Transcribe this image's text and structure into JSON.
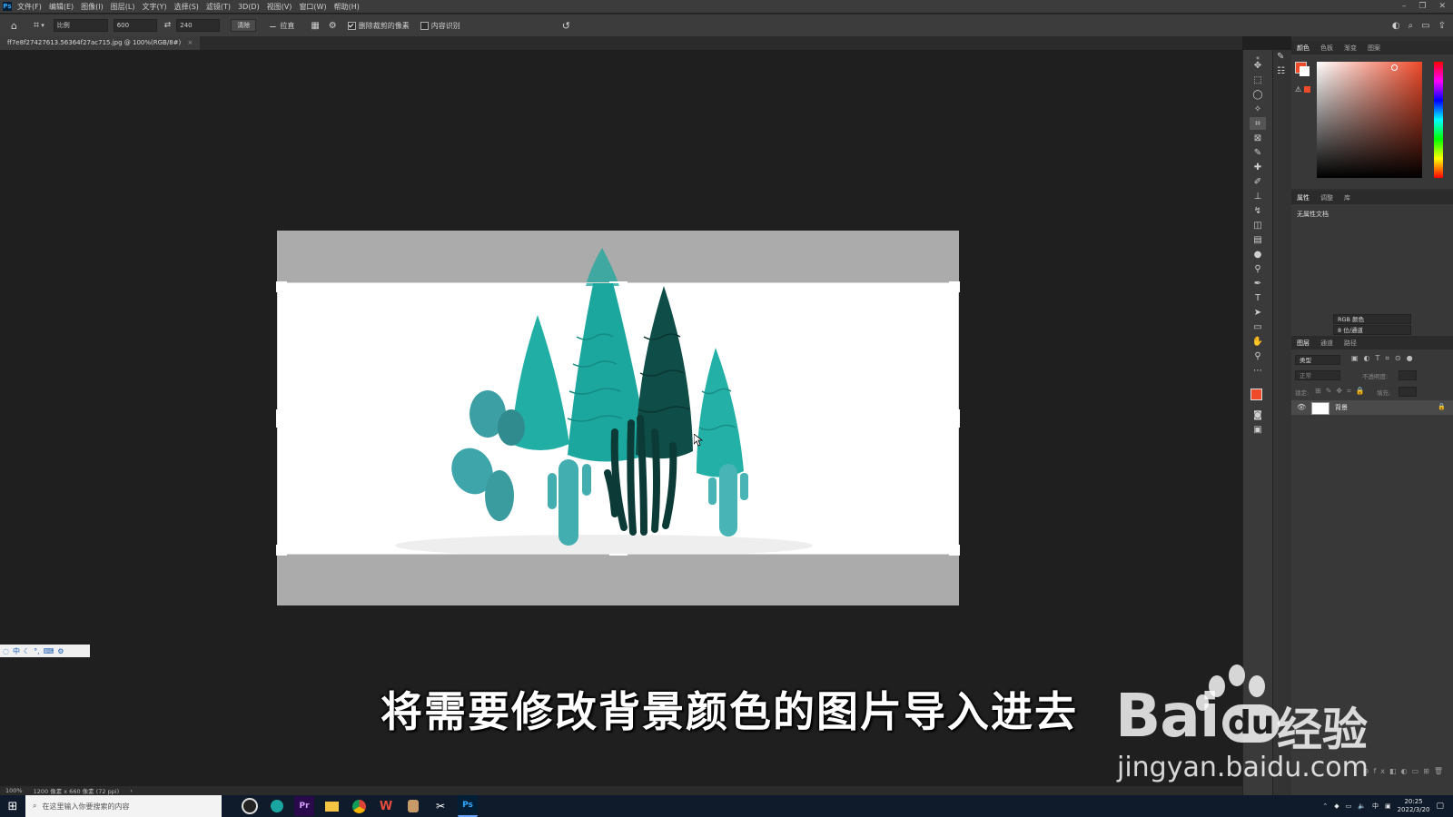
{
  "app": {
    "logo": "Ps",
    "menus": [
      "文件(F)",
      "编辑(E)",
      "图像(I)",
      "图层(L)",
      "文字(Y)",
      "选择(S)",
      "滤镜(T)",
      "3D(D)",
      "视图(V)",
      "窗口(W)",
      "帮助(H)"
    ]
  },
  "options": {
    "ratio_label": "比例",
    "width_value": "600",
    "height_value": "240",
    "clear_label": "清除",
    "straighten_label": "拉直",
    "delete_cropped_label": "删除裁剪的像素",
    "delete_cropped_checked": true,
    "content_aware_label": "内容识别",
    "content_aware_checked": false
  },
  "document": {
    "tab_title": "ff7e8f27427613.56364f27ac715.jpg @ 100%(RGB/8#)",
    "status_zoom": "100%",
    "status_info": "1200 像素 x 660 像素 (72 ppi)"
  },
  "subtitle": "将需要修改背景颜色的图片导入进去",
  "ime": {
    "mode": "中"
  },
  "panels": {
    "color_tabs": [
      "颜色",
      "色板",
      "渐变",
      "图案"
    ],
    "properties_tabs": [
      "属性",
      "调整",
      "库"
    ],
    "properties_title": "无属性文档",
    "mode_select": "RGB 颜色",
    "depth_select": "8 位/通道",
    "layers_tabs": [
      "图层",
      "通道",
      "路径"
    ],
    "layer_search_placeholder": "类型",
    "blend_mode": "正常",
    "opacity_label": "不透明度:",
    "lock_label": "锁定:",
    "fill_label": "填充:",
    "layer_name": "背景",
    "colors": {
      "foreground": "#ef4a2a",
      "background": "#ffffff"
    }
  },
  "taskbar": {
    "search_placeholder": "在这里输入你要搜索的内容",
    "apps": [
      "obs",
      "edge",
      "Pr",
      "files",
      "chrome",
      "W",
      "app",
      "capcut",
      "Ps"
    ],
    "tray_lang": "中",
    "time": "20:25",
    "date": "2022/3/20"
  },
  "watermark": {
    "brand": "Bai",
    "brand_suffix": "du",
    "brand_cn": "经验",
    "url": "jingyan.baidu.com"
  }
}
